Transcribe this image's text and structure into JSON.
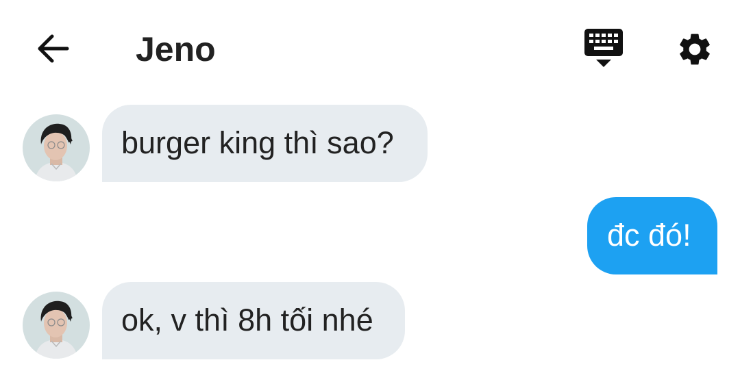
{
  "header": {
    "title": "Jeno",
    "icons": {
      "back": "arrow-left-icon",
      "keyboard": "keyboard-icon",
      "settings": "gear-icon"
    }
  },
  "messages": [
    {
      "sender": "contact",
      "text": "burger king thì sao?",
      "avatar": "contact-avatar"
    },
    {
      "sender": "me",
      "text": "đc đó!"
    },
    {
      "sender": "contact",
      "text": "ok, v thì 8h tối nhé",
      "avatar": "contact-avatar"
    }
  ],
  "colors": {
    "incoming_bubble": "#e7ecf0",
    "outgoing_bubble": "#1da1f2",
    "outgoing_text": "#ffffff",
    "text": "#222222"
  }
}
